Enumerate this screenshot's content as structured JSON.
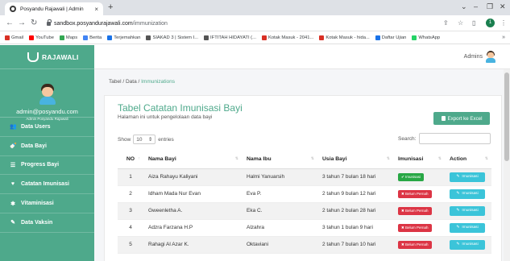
{
  "browser": {
    "tab_title": "Posyandu Rajawali | Admin",
    "tab_close": "×",
    "new_tab": "+",
    "url_host": "sandbox.posyandurajawali.com",
    "url_path": "/immunization",
    "profile_initial": "1",
    "bookmarks": [
      "Gmail",
      "YouTube",
      "Maps",
      "Berita",
      "Terjemahkan",
      "SIAKAD 3 | Sistem I...",
      "IFTITAH HIDAYATI (...",
      "Kotak Masuk - 2041...",
      "Kotak Masuk - hida...",
      "Daftar Ujian",
      "WhatsApp"
    ],
    "bookmark_colors": [
      "#d93025",
      "#ff0000",
      "#34a853",
      "#4285f4",
      "#1a73e8",
      "#555555",
      "#555555",
      "#d93025",
      "#d93025",
      "#1a73e8",
      "#25d366"
    ],
    "bookmarks_more": "»"
  },
  "sidebar": {
    "brand": "RAJAWALI",
    "email": "admin@posyandu.com",
    "role": "Admin Posyandu Rajawali",
    "items": [
      {
        "icon": "👥",
        "label": "Data Users"
      },
      {
        "icon": "🍼",
        "label": "Data Bayi"
      },
      {
        "icon": "☰",
        "label": "Progress Bayi"
      },
      {
        "icon": "♥",
        "label": "Catatan Imunisasi"
      },
      {
        "icon": "✱",
        "label": "Vitaminisasi"
      },
      {
        "icon": "✎",
        "label": "Data Vaksin"
      }
    ]
  },
  "topbar": {
    "user": "Admins"
  },
  "breadcrumb": {
    "part1": "Tabel",
    "sep1": " / ",
    "part2": "Data",
    "sep2": " / ",
    "current": "Immunizations"
  },
  "page": {
    "title": "Tabel Catatan Imunisasi Bayi",
    "subtitle": "Halaman ini untuk pengelolaan data bayi",
    "export_label": "Export ke Excel",
    "show_label": "Show",
    "entries_value": "10",
    "entries_label": "entries",
    "search_label": "Search:"
  },
  "table": {
    "headers": [
      "NO",
      "Nama Bayi",
      "Nama Ibu",
      "Usia Bayi",
      "Imunisasi",
      "Action"
    ],
    "rows": [
      {
        "no": "1",
        "bayi": "Aiza Rahayu Kaliyani",
        "ibu": "Halmi Yanuarsih",
        "usia": "3 tahun 7 bulan 18 hari",
        "status": "Sudah",
        "status_label": "✔ Imunisasi",
        "action": "Imunisasi"
      },
      {
        "no": "2",
        "bayi": "Idham Mada Nur Evan",
        "ibu": "Eva P.",
        "usia": "2 tahun 9 bulan 12 hari",
        "status": "Belum",
        "status_label": "✖ Belum Pernah",
        "action": "Imunisasi"
      },
      {
        "no": "3",
        "bayi": "Gweenletha A.",
        "ibu": "Eka C.",
        "usia": "2 tahun 2 bulan 28 hari",
        "status": "Belum",
        "status_label": "✖ Belum Pernah",
        "action": "Imunisasi"
      },
      {
        "no": "4",
        "bayi": "Adzra Farzana H.P",
        "ibu": "Alzahra",
        "usia": "3 tahun 1 bulan 9 hari",
        "status": "Belum",
        "status_label": "✖ Belum Pernah",
        "action": "Imunisasi"
      },
      {
        "no": "5",
        "bayi": "Rahagi Al Azar K.",
        "ibu": "Oktaviani",
        "usia": "2 tahun 7 bulan 10 hari",
        "status": "Belum",
        "status_label": "✖ Belum Pernah",
        "action": "Imunisasi"
      }
    ]
  },
  "colors": {
    "brand": "#4ea98b",
    "success": "#28a745",
    "danger": "#dc3545",
    "info": "#3bc4d9"
  }
}
